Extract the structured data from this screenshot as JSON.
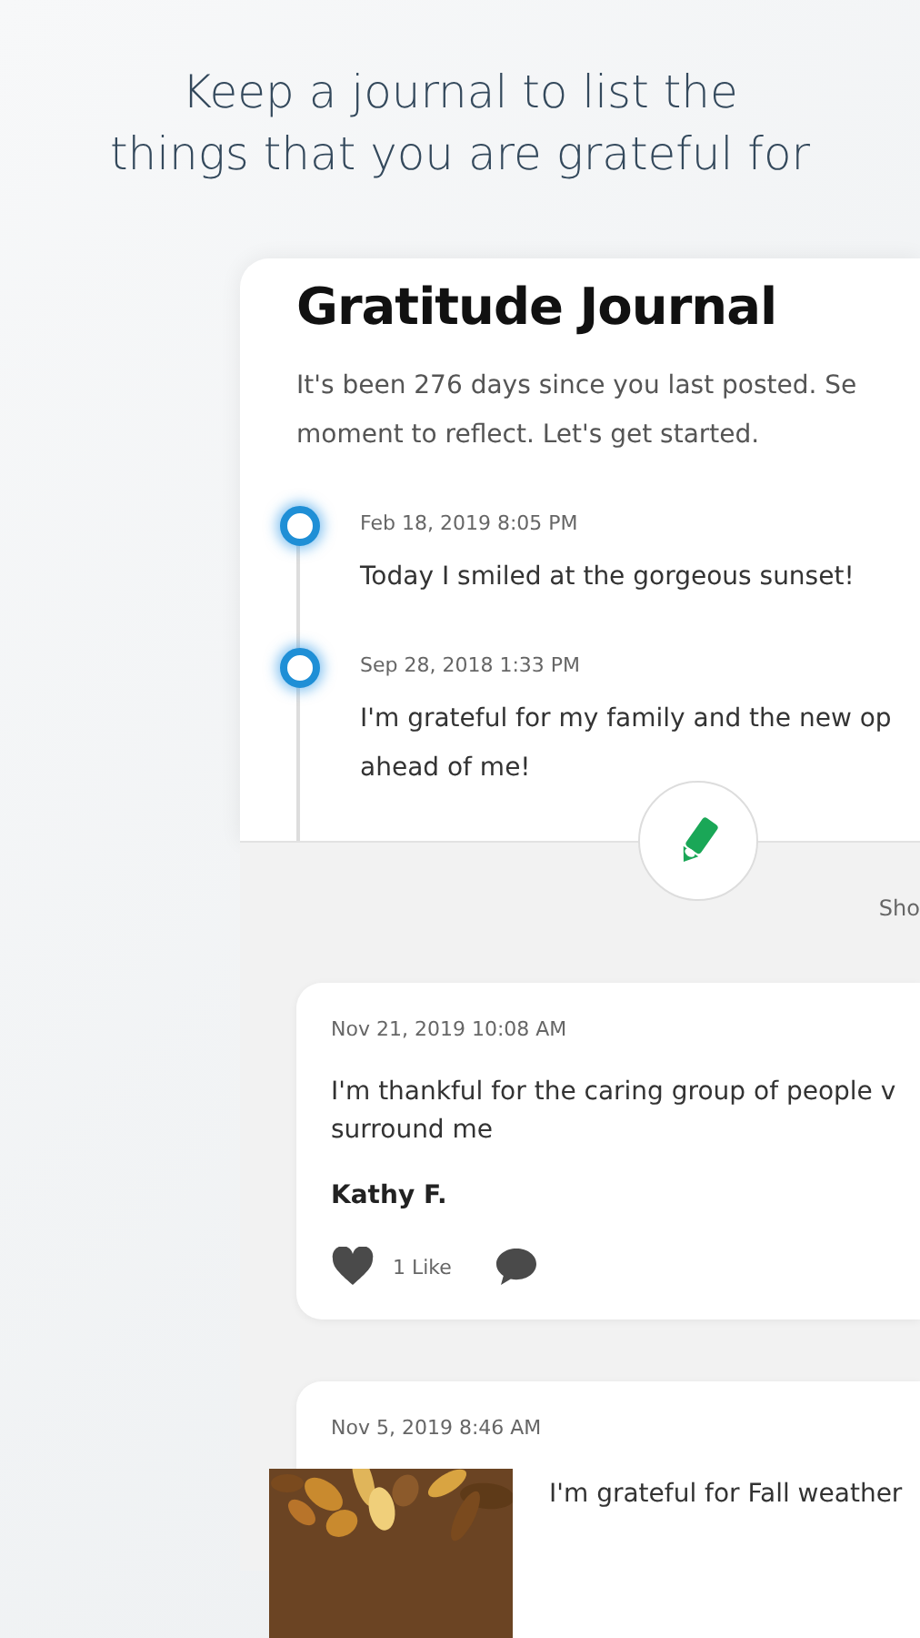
{
  "headline": "Keep a journal to list the\nthings that you are grateful for",
  "journal": {
    "title": "Gratitude Journal",
    "intro": "It's been 276 days since you last posted. Se\nmoment to reflect. Let's get started.",
    "timeline": [
      {
        "date": "Feb 18, 2019 8:05 PM",
        "text": "Today I smiled at the gorgeous sunset!"
      },
      {
        "date": "Sep 28, 2018 1:33 PM",
        "text": "I'm grateful for my family and the new op\nahead of me!"
      }
    ],
    "show_link": "Sho"
  },
  "posts": [
    {
      "kind": "text",
      "date": "Nov 21, 2019 10:08 AM",
      "text": "I'm thankful for the caring group of people v\nsurround me",
      "author": "Kathy F.",
      "likes": "1 Like"
    },
    {
      "date": "Nov 5, 2019 8:46 AM",
      "text": "I'm grateful for Fall weather"
    }
  ]
}
